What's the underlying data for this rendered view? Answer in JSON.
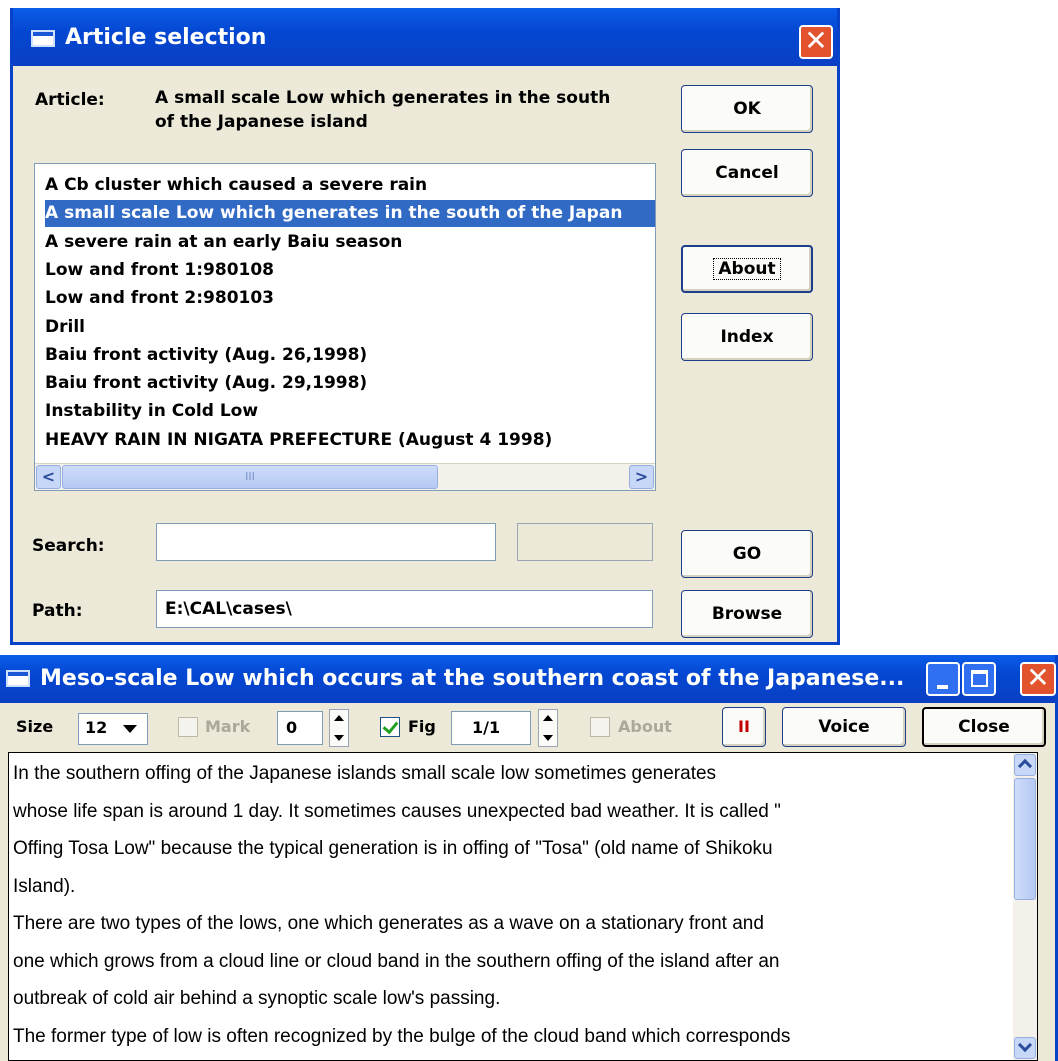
{
  "dialog": {
    "title": "Article selection",
    "close_glyph": "✕",
    "article_label": "Article:",
    "article_value_line1": "A small scale Low which generates in the south",
    "article_value_line2": "of the Japanese island",
    "list_items": [
      "A Cb cluster which caused a severe rain",
      "A small scale Low which generates in the south of the Japan",
      "A severe rain at an early Baiu season",
      "Low and front 1:980108",
      "Low and front 2:980103",
      "Drill",
      "Baiu front activity (Aug. 26,1998)",
      "Baiu front activity (Aug. 29,1998)",
      "Instability in Cold Low",
      "HEAVY RAIN IN NIGATA PREFECTURE (August 4 1998)"
    ],
    "selected_index": 1,
    "scroll_left_glyph": "<",
    "scroll_right_glyph": ">",
    "scroll_grip": "III",
    "buttons": {
      "ok": "OK",
      "cancel": "Cancel",
      "about": "About",
      "index": "Index",
      "go": "GO",
      "browse": "Browse"
    },
    "search_label": "Search:",
    "search_value": "",
    "path_label": "Path:",
    "path_value": "E:\\CAL\\cases\\"
  },
  "viewer": {
    "title": "Meso-scale Low which occurs at the southern coast of the Japanese...",
    "toolbar": {
      "size_label": "Size",
      "size_value": "12",
      "mark_label": "Mark",
      "mark_value": "0",
      "fig_label": "Fig",
      "fig_checked": true,
      "fig_value": "1/1",
      "about_label": "About",
      "pause_glyph": "II",
      "voice_label": "Voice",
      "close_label": "Close"
    },
    "text_lines": [
      "In the southern offing of the Japanese islands small scale low sometimes generates",
      "whose life span is around 1 day. It sometimes causes unexpected bad weather. It is called \"",
      "Offing Tosa Low\" because the typical generation is in offing of \"Tosa\" (old name of Shikoku",
      "Island).",
      "There are two types of the lows, one which generates as a wave on a stationary front and",
      "one which grows from a cloud line or cloud band in the southern offing of the island after an",
      "outbreak of cold air behind a synoptic scale low's passing.",
      "The former type of low is often recognized by the bulge of the cloud band which corresponds"
    ]
  },
  "colors": {
    "titlebar": "#0447d2",
    "selection": "#316ac5",
    "window_bg": "#ece9d8",
    "close_red": "#e2522c"
  }
}
